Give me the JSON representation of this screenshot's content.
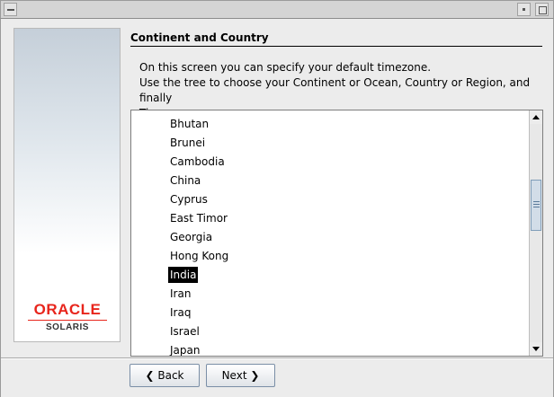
{
  "window": {
    "controls": [
      "window-menu-icon",
      "iconify-icon",
      "maximize-icon"
    ]
  },
  "sidebar": {
    "brand": "ORACLE",
    "product": "SOLARIS"
  },
  "page": {
    "title": "Continent and Country",
    "description_line1": "On this screen you can specify your default timezone.",
    "description_line2": "Use the tree to choose your Continent or Ocean, Country or Region, and finally",
    "description_line3": "Timezone."
  },
  "tree": {
    "items": [
      "Bhutan",
      "Brunei",
      "Cambodia",
      "China",
      "Cyprus",
      "East Timor",
      "Georgia",
      "Hong Kong",
      "India",
      "Iran",
      "Iraq",
      "Israel",
      "Japan"
    ],
    "selected": "India"
  },
  "buttons": {
    "back_label": "Back",
    "next_label": "Next"
  },
  "colors": {
    "brand_red": "#e8251c",
    "selection_bg": "#000000",
    "button_border": "#7a8ea6"
  }
}
